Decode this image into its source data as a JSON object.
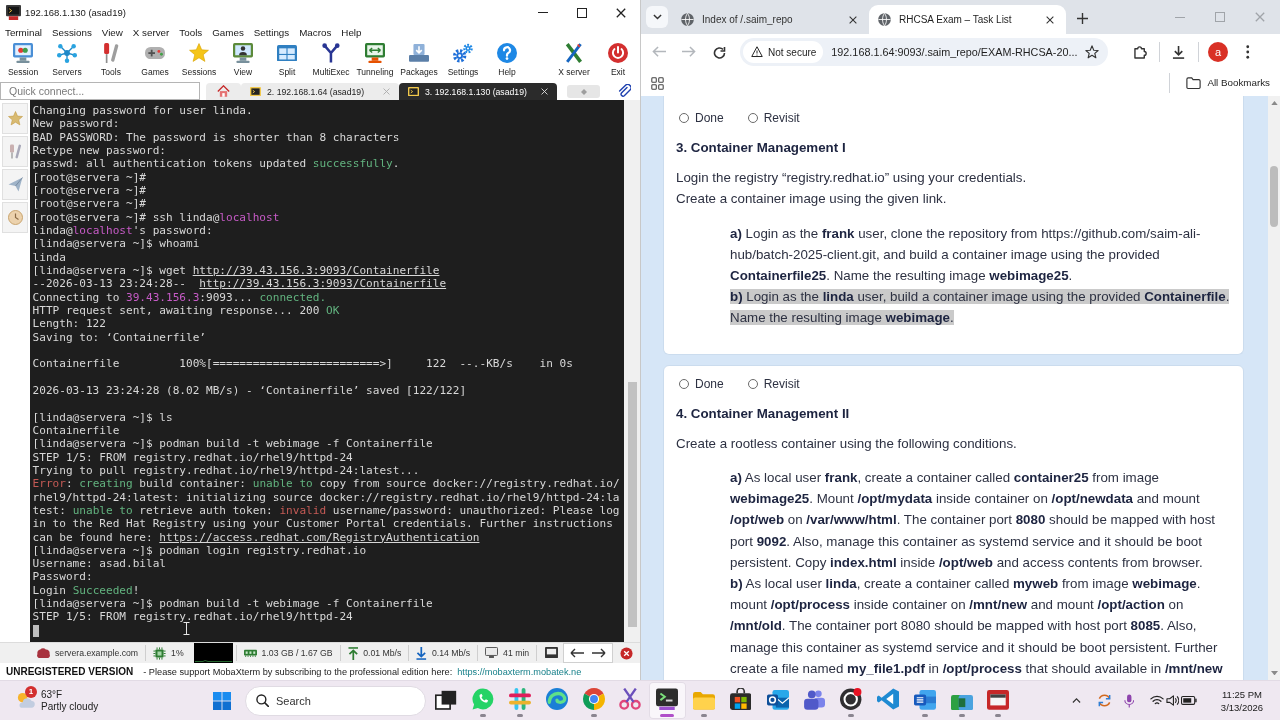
{
  "terminal_app": {
    "title": "192.168.1.130 (asad19)",
    "menu": [
      "Terminal",
      "Sessions",
      "View",
      "X server",
      "Tools",
      "Games",
      "Settings",
      "Macros",
      "Help"
    ],
    "toolbar": [
      "Session",
      "Servers",
      "Tools",
      "Games",
      "Sessions",
      "View",
      "Split",
      "MultiExec",
      "Tunneling",
      "Packages",
      "Settings",
      "Help",
      "X server",
      "Exit"
    ],
    "quick_connect": {
      "placeholder": "Quick connect..."
    },
    "tabs": [
      {
        "label": "2. 192.168.1.64 (asad19)",
        "selected": false
      },
      {
        "label": "3. 192.168.1.130 (asad19)",
        "selected": true
      }
    ],
    "output": [
      [
        [
          "Changing password for user linda."
        ],
        [
          "New password:"
        ],
        [
          "BAD PASSWORD: The password is shorter than 8 characters"
        ],
        [
          "Retype new password:"
        ],
        [
          "passwd: all authentication tokens updated ",
          {
            "text": "successfully",
            "kind": "ok"
          },
          "."
        ],
        [
          "[root@servera ~]#"
        ],
        [
          "[root@servera ~]#"
        ],
        [
          "[root@servera ~]#"
        ],
        [
          "[root@servera ~]# ssh linda@",
          {
            "text": "localhost",
            "kind": "host"
          }
        ],
        [
          "linda@",
          {
            "text": "localhost",
            "kind": "host"
          },
          "'s password:"
        ],
        [
          "[linda@servera ~]$ whoami"
        ],
        [
          "linda"
        ],
        [
          "[linda@servera ~]$ wget ",
          {
            "text": "http://39.43.156.3:9093/Containerfile",
            "kind": "link"
          }
        ],
        [
          "--2026-03-13 23:24:28--  ",
          {
            "text": "http://39.43.156.3:9093/Containerfile",
            "kind": "link"
          }
        ],
        [
          "Connecting to ",
          {
            "text": "39.43.156.3",
            "kind": "host"
          },
          ":9093... ",
          {
            "text": "connected.",
            "kind": "ok"
          }
        ],
        [
          "HTTP request sent, awaiting response... 200 ",
          {
            "text": "OK",
            "kind": "ok"
          }
        ],
        [
          "Length: 122"
        ],
        [
          "Saving to: ‘Containerfile’"
        ]
      ],
      [
        [
          "Containerfile         100%[=========================>]     122  --.-KB/s    in 0s"
        ]
      ],
      [
        [
          "2026-03-13 23:24:28 (8.02 MB/s) - ‘Containerfile’ saved [122/122]"
        ]
      ],
      [
        [
          "[linda@servera ~]$ ls"
        ],
        [
          "Containerfile"
        ],
        [
          "[linda@servera ~]$ podman build -t webimage -f Containerfile"
        ],
        [
          "STEP 1/5: FROM registry.redhat.io/rhel9/httpd-24"
        ],
        [
          "Trying to pull registry.redhat.io/rhel9/httpd-24:latest..."
        ],
        [
          {
            "text": "Error",
            "kind": "error"
          },
          ": ",
          {
            "text": "creating",
            "kind": "ok"
          },
          " build container: ",
          {
            "text": "unable to",
            "kind": "ok"
          },
          " copy from source docker://registry.redhat.io/"
        ],
        [
          "rhel9/httpd-24:latest: initializing source docker://registry.redhat.io/rhel9/httpd-24:la"
        ],
        [
          "test: ",
          {
            "text": "unable to",
            "kind": "ok"
          },
          " retrieve auth token: ",
          {
            "text": "invalid",
            "kind": "error"
          },
          " username/password: unauthorized: Please log"
        ],
        [
          "in to the Red Hat Registry using your Customer Portal credentials. Further instructions"
        ],
        [
          "can be found here: ",
          {
            "text": "https://access.redhat.com/RegistryAuthentication",
            "kind": "link"
          }
        ],
        [
          "[linda@servera ~]$ podman login registry.redhat.io"
        ],
        [
          "Username: asad.bilal"
        ],
        [
          "Password:"
        ],
        [
          "Login ",
          {
            "text": "Succeeded",
            "kind": "ok"
          },
          "!"
        ],
        [
          "[linda@servera ~]$ podman build -t webimage -f Containerfile"
        ],
        [
          "STEP 1/5: FROM registry.redhat.io/rhel9/httpd-24"
        ]
      ]
    ],
    "cursor": true,
    "status": [
      "servera.example.com",
      "1%",
      "1.03 GB / 1.67 GB",
      "0.01 Mb/s",
      "0.14 Mb/s",
      "41 min"
    ],
    "banner": {
      "title": "UNREGISTERED VERSION",
      "message": "- Please support MobaXterm by subscribing to the professional edition here:",
      "link": "https://mobaxterm.mobatek.ne"
    }
  },
  "browser": {
    "tabs": [
      {
        "title": "Index of /.saim_repo",
        "selected": false
      },
      {
        "title": "RHCSA Exam – Task List",
        "selected": true
      }
    ],
    "back": {
      "disabled": true
    },
    "forward": {
      "disabled": true
    },
    "security": "Not secure",
    "url": "192.168.1.64:9093/.saim_repo/EXAM-RHCSA-20...",
    "avatar": "a",
    "bookmarks_folder": "All Bookmarks",
    "tasks": [
      {
        "options": [
          {
            "label": "Done",
            "selected": false
          },
          {
            "label": "Revisit",
            "selected": false
          }
        ],
        "heading": "3. Container Management I",
        "paragraphs": [
          "Login the registry “registry.redhat.io” using your credentials.",
          "Create a container image using the given link."
        ],
        "items": [
          {
            "text": "**a)** Login as the **frank** user, clone the repository from https://github.com/saim-ali-hub/batch-2025-client.git, and build a container image using the provided **Containerfile25**. Name the resulting image **webimage25**.",
            "selected": false
          },
          {
            "text": "**b)** Login as the **linda** user, build a container image using the provided **Containerfile**. Name the resulting image **webimage**.",
            "selected": true
          }
        ]
      },
      {
        "options": [
          {
            "label": "Done",
            "selected": false
          },
          {
            "label": "Revisit",
            "selected": false
          }
        ],
        "heading": "4. Container Management II",
        "paragraphs": [
          "Create a rootless container using the following conditions."
        ],
        "items": [
          {
            "text": "**a)** As local user **frank**, create a container called **container25** from image **webimage25**. Mount **/opt/mydata** inside container on **/opt/newdata** and mount **/opt/web** on **/var/www/html**. The container port **8080** should be mapped with host port **9092**. Also, manage this container as systemd service and it should be boot persistent. Copy **index.html** inside **/opt/web** and access contents from browser.",
            "selected": false
          },
          {
            "text": "**b)** As local user **linda**, create a container called **myweb** from image **webimage**. mount **/opt/process** inside container on **/mnt/new** and mount **/opt/action** on **/mnt/old**. The container port 8080 should be mapped with host port **8085**. Also, manage this container as systemd service and it should be boot persistent. Further create a file named **my_file1.pdf** in **/opt/process** that should available in **/mnt/new**",
            "selected": false
          }
        ]
      }
    ]
  },
  "taskbar": {
    "weather": {
      "badge": "1",
      "temperature": "63°F",
      "condition": "Partly cloudy"
    },
    "search": {
      "placeholder": "Search"
    },
    "apps": [
      {
        "running": false,
        "selected": false
      },
      {
        "running": true,
        "selected": false
      },
      {
        "running": true,
        "selected": false
      },
      {
        "running": false,
        "selected": false
      },
      {
        "running": true,
        "selected": false
      },
      {
        "running": false,
        "selected": false
      },
      {
        "running": true,
        "selected": true
      },
      {
        "running": true,
        "selected": false
      },
      {
        "running": false,
        "selected": false
      },
      {
        "running": false,
        "selected": false
      },
      {
        "running": false,
        "selected": false
      },
      {
        "running": true,
        "selected": false
      },
      {
        "running": false,
        "selected": false
      },
      {
        "running": true,
        "selected": false
      },
      {
        "running": true,
        "selected": false
      },
      {
        "running": true,
        "selected": false
      }
    ],
    "time": "11:25 PM",
    "date": "3/13/2026"
  }
}
